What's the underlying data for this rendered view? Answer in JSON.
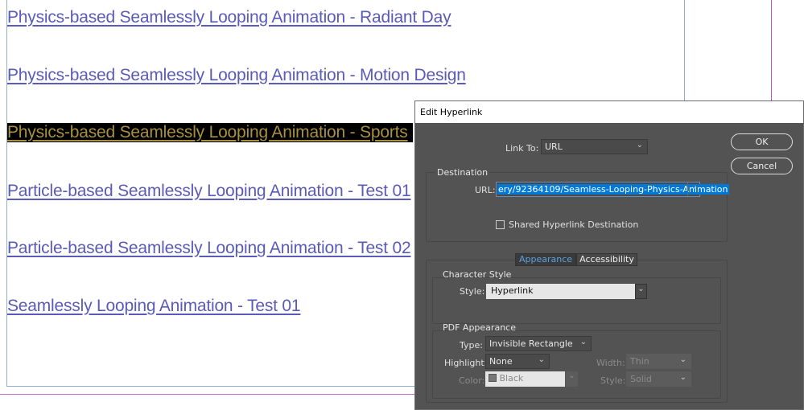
{
  "document": {
    "links": [
      "Physics-based Seamlessly Looping Animation - Radiant Day",
      "Physics-based Seamlessly Looping Animation - Motion Design",
      "Physics-based Seamlessly Looping Animation - Sports",
      "Particle-based Seamlessly Looping Animation - Test 01",
      "Particle-based Seamlessly Looping Animation - Test 02",
      "Seamlessly Looping Animation - Test 01"
    ]
  },
  "dialog": {
    "title": "Edit Hyperlink",
    "ok_label": "OK",
    "cancel_label": "Cancel",
    "link_to_label": "Link To:",
    "link_to_value": "URL",
    "destination_label": "Destination",
    "url_label": "URL:",
    "url_value": "ery/92364109/Seamless-Looping-Physics-Animation",
    "shared_label": "Shared Hyperlink Destination",
    "shared_checked": false,
    "tabs": [
      "Appearance",
      "Accessibility"
    ],
    "active_tab": "Appearance",
    "char_style_label": "Character Style",
    "style_label": "Style:",
    "style_value": "Hyperlink",
    "pdf_label": "PDF Appearance",
    "type_label": "Type:",
    "type_value": "Invisible Rectangle",
    "highlight_label": "Highlight:",
    "highlight_value": "None",
    "width_label": "Width:",
    "width_value": "Thin",
    "color_label": "Color:",
    "color_value": "Black",
    "style2_label": "Style:",
    "style2_value": "Solid"
  },
  "colors": {
    "link": "#5a5ab8",
    "selection": "#0078d7",
    "dialog_bg": "#535353"
  }
}
